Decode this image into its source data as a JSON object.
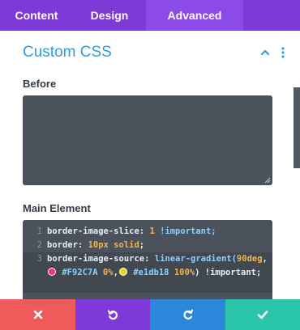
{
  "tabs": [
    {
      "label": "Content"
    },
    {
      "label": "Design"
    },
    {
      "label": "Advanced"
    }
  ],
  "section": {
    "title": "Custom CSS"
  },
  "fields": {
    "before_label": "Before",
    "before_value": "",
    "main_label": "Main Element"
  },
  "code": {
    "line_numbers": [
      "1",
      "2",
      "3"
    ],
    "line1": {
      "prop": "border-image-slice: ",
      "value": "1",
      "flag": " !important;"
    },
    "line2": {
      "prop": "border: ",
      "value": "10px solid",
      "end": ";"
    },
    "line3": {
      "prop": "border-image-source: ",
      "func": "linear-gradient(",
      "arg1": "90deg",
      "sep1": ",",
      "color1": "#F92C7A",
      "stop1": "0%",
      "sep2": ",",
      "color2": "#e1db18",
      "stop2": "100%",
      "close": ") !important;"
    }
  },
  "colors": {
    "tab_bar": "#7d3ad8",
    "accent_blue": "#2d9ee6",
    "cancel": "#ef5b5b",
    "undo": "#7d3ad8",
    "redo": "#2b87da",
    "save": "#29c4a9",
    "swatch1": "#F92C7A",
    "swatch2": "#e1db18"
  },
  "icons": {
    "collapse": "chevron-up-icon",
    "menu": "kebab-icon",
    "cancel": "close-icon",
    "undo": "undo-icon",
    "redo": "redo-icon",
    "save": "check-icon"
  }
}
